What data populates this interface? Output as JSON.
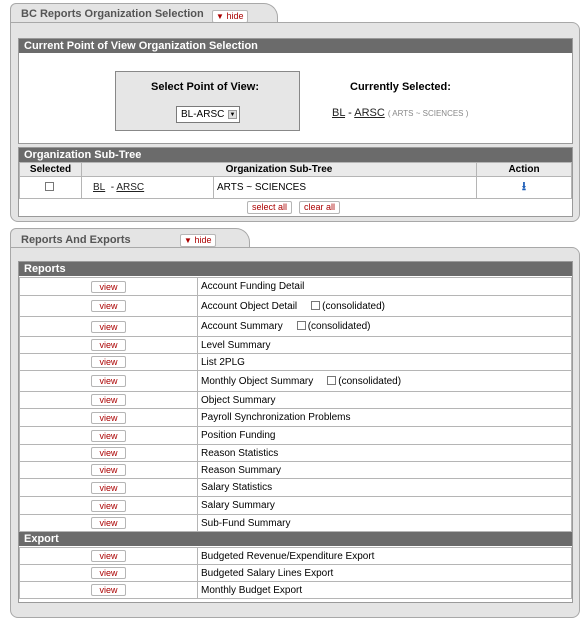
{
  "section1": {
    "title": "BC Reports Organization Selection",
    "hide_label": "hide",
    "pov_header": "Current Point of View Organization Selection",
    "select_pov_label": "Select Point of View:",
    "select_value": "BL-ARSC",
    "currently_selected_label": "Currently Selected:",
    "current_chart": "BL",
    "current_dash": "-",
    "current_org": "ARSC",
    "current_desc": "( ARTS ~ SCIENCES )",
    "subtree_header": "Organization Sub-Tree",
    "columns": [
      "Selected",
      "Organization Sub-Tree",
      "Action"
    ],
    "row": {
      "chart": "BL",
      "dash": "-",
      "org": "ARSC",
      "name": "ARTS ~ SCIENCES"
    },
    "select_all_label": "select all",
    "clear_all_label": "clear all"
  },
  "section2": {
    "title": "Reports And Exports",
    "hide_label": "hide",
    "reports_header": "Reports",
    "export_header": "Export",
    "view_label": "view",
    "consolidated_label": "(consolidated)",
    "reports": [
      {
        "name": "Account Funding Detail",
        "consolidated": false
      },
      {
        "name": "Account Object Detail",
        "consolidated": true
      },
      {
        "name": "Account Summary",
        "consolidated": true
      },
      {
        "name": "Level Summary",
        "consolidated": false
      },
      {
        "name": "List 2PLG",
        "consolidated": false
      },
      {
        "name": "Monthly Object Summary",
        "consolidated": true
      },
      {
        "name": "Object Summary",
        "consolidated": false
      },
      {
        "name": "Payroll Synchronization Problems",
        "consolidated": false
      },
      {
        "name": "Position Funding",
        "consolidated": false
      },
      {
        "name": "Reason Statistics",
        "consolidated": false
      },
      {
        "name": "Reason Summary",
        "consolidated": false
      },
      {
        "name": "Salary Statistics",
        "consolidated": false
      },
      {
        "name": "Salary Summary",
        "consolidated": false
      },
      {
        "name": "Sub-Fund Summary",
        "consolidated": false
      }
    ],
    "exports": [
      {
        "name": "Budgeted Revenue/Expenditure Export"
      },
      {
        "name": "Budgeted Salary Lines Export"
      },
      {
        "name": "Monthly Budget Export"
      }
    ]
  },
  "icons": {
    "hide": "triangle-down-icon",
    "action": "download-arrow-icon"
  }
}
